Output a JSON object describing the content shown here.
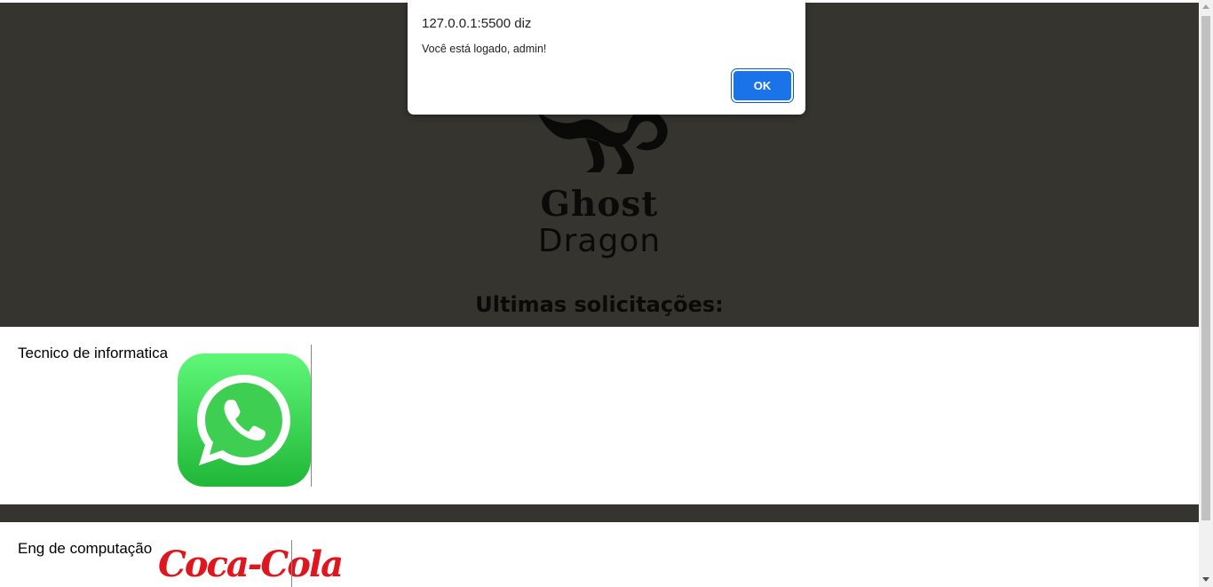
{
  "header": {
    "brand_line_1": "Ghost",
    "brand_line_2": "Dragon",
    "section_title": "Ultimas solicitações:"
  },
  "requests": [
    {
      "title": "Tecnico de informatica",
      "logo": "whatsapp-logo"
    },
    {
      "title": "Eng de computação",
      "logo": "coca-cola-logo",
      "logo_text": "Coca-Cola"
    }
  ],
  "alert": {
    "origin": "127.0.0.1:5500 diz",
    "message": "Você está logado, admin!",
    "ok_label": "OK"
  },
  "colors": {
    "header_bg": "#35342f",
    "ok_button": "#1a73e8",
    "whatsapp_green": "#28c940",
    "coca_cola_red": "#e0161e"
  }
}
